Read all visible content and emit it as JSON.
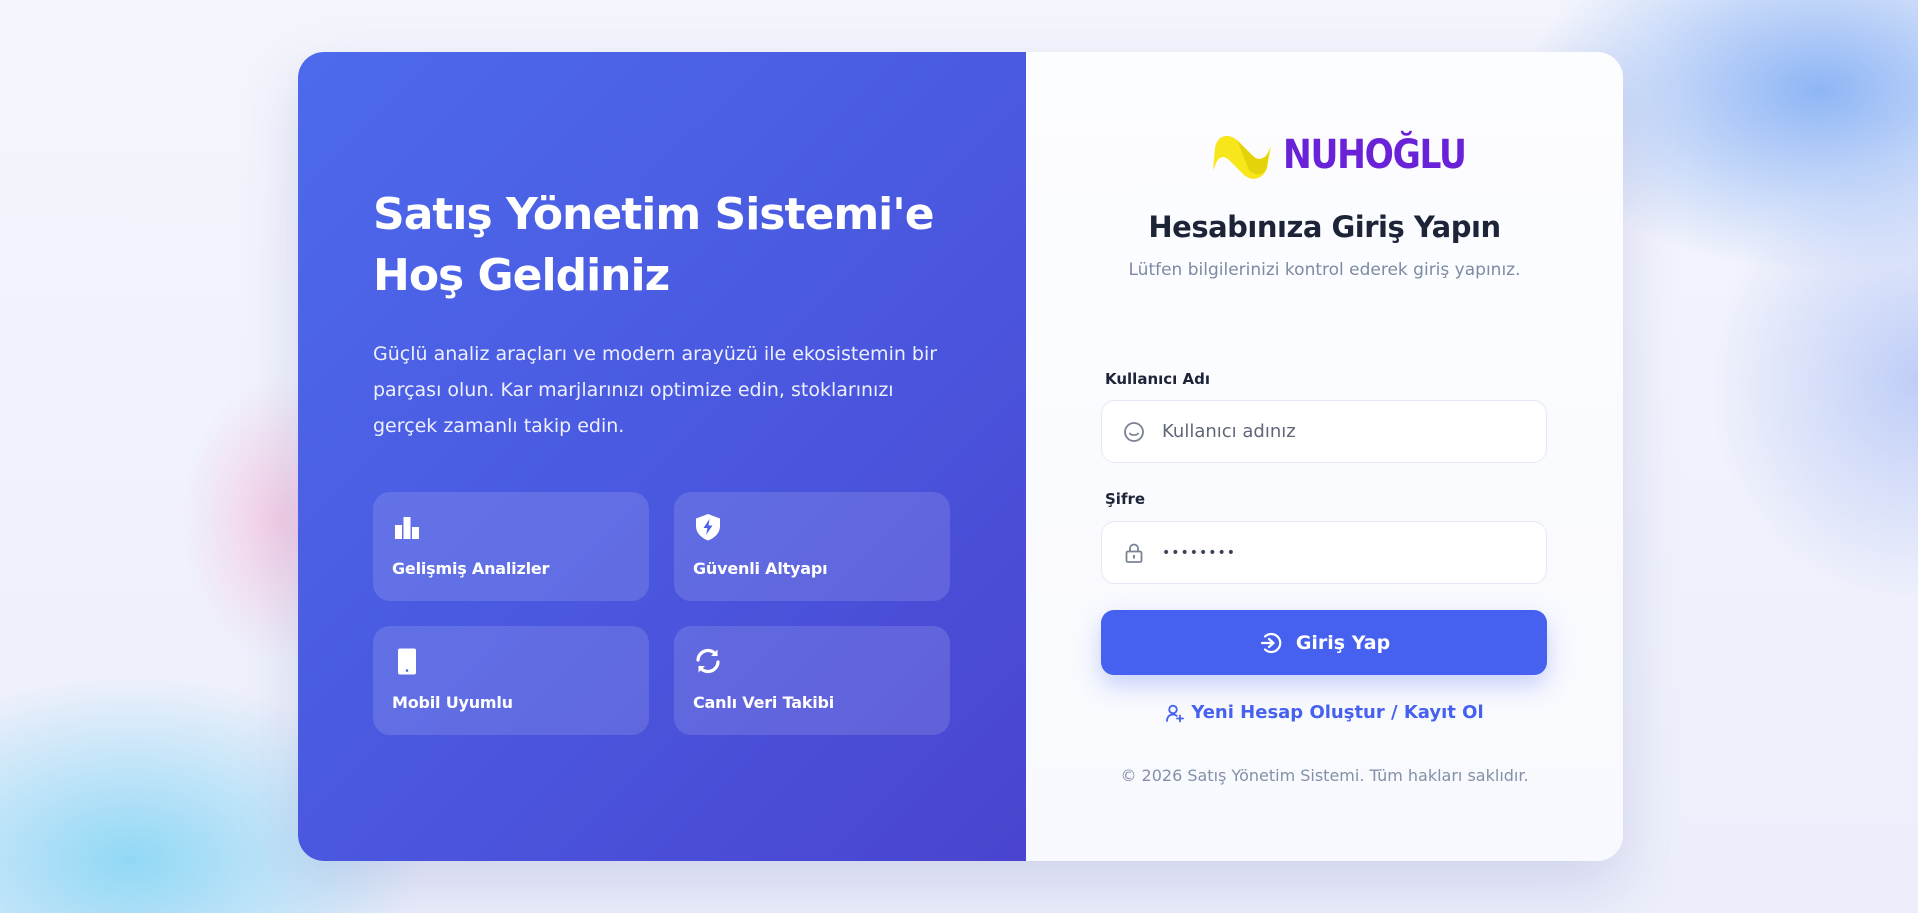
{
  "left": {
    "title": "Satış Yönetim Sistemi'e Hoş Geldiniz",
    "description": "Güçlü analiz araçları ve modern arayüzü ile ekosistemin bir parçası olun. Kar marjlarınızı optimize edin, stoklarınızı gerçek zamanlı takip edin.",
    "features": [
      {
        "label": "Gelişmiş Analizler",
        "icon": "bar-chart-icon"
      },
      {
        "label": "Güvenli Altyapı",
        "icon": "shield-bolt-icon"
      },
      {
        "label": "Mobil Uyumlu",
        "icon": "mobile-icon"
      },
      {
        "label": "Canlı Veri Takibi",
        "icon": "sync-icon"
      }
    ]
  },
  "login": {
    "logo_text": "NUHOĞLU",
    "title": "Hesabınıza Giriş Yapın",
    "subtitle": "Lütfen bilgilerinizi kontrol ederek giriş yapınız.",
    "username": {
      "label": "Kullanıcı Adı",
      "placeholder": "Kullanıcı adınız",
      "value": "",
      "icon": "smile-icon"
    },
    "password": {
      "label": "Şifre",
      "value": "••••••••",
      "icon": "lock-icon"
    },
    "submit_label": "Giriş Yap",
    "submit_icon": "login-arrow-icon",
    "register_label": "Yeni Hesap Oluştur / Kayıt Ol",
    "register_icon": "user-plus-icon",
    "footer": "© 2026 Satış Yönetim Sistemi. Tüm hakları saklıdır."
  },
  "colors": {
    "primary": "#4660ef",
    "panel_gradient_start": "#4d6aec",
    "panel_gradient_end": "#4a44cf",
    "logo_yellow": "#f6e61a",
    "logo_purple": "#6a22d8",
    "heading": "#1e2438",
    "muted": "#7d8aa2"
  }
}
